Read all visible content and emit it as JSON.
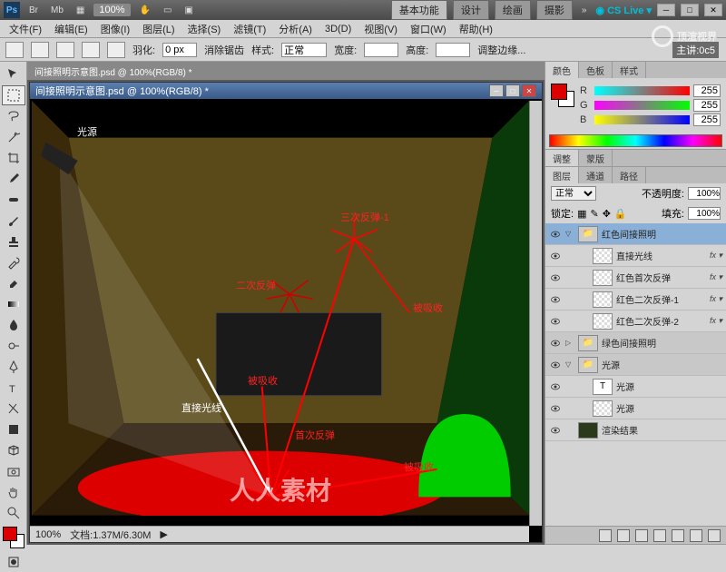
{
  "titlebar": {
    "ps": "Ps",
    "zoom": "100%",
    "workspaces": [
      "基本功能",
      "设计",
      "绘画",
      "摄影"
    ],
    "cslive": "CS Live",
    "lesson": "主讲:0c5"
  },
  "menu": [
    "文件(F)",
    "编辑(E)",
    "图像(I)",
    "图层(L)",
    "选择(S)",
    "滤镜(T)",
    "分析(A)",
    "3D(D)",
    "视图(V)",
    "窗口(W)",
    "帮助(H)"
  ],
  "optbar": {
    "feather_label": "羽化:",
    "feather_value": "0 px",
    "antialias": "消除锯齿",
    "style_label": "样式:",
    "style_value": "正常",
    "width_label": "宽度:",
    "height_label": "高度:",
    "refine": "调整边缘..."
  },
  "doc": {
    "tab": "间接照明示意图.psd @ 100%(RGB/8) *",
    "zoom": "100%",
    "fileinfo": "文档:1.37M/6.30M"
  },
  "annotations": {
    "light": "光源",
    "direct": "直接光线",
    "first_bounce": "首次反弹",
    "second_bounce": "二次反弹",
    "third_bounce": "三次反弹-1",
    "absorbed1": "被吸收",
    "absorbed2": "被吸收",
    "absorbed3": "被吸收"
  },
  "color_panel": {
    "tabs": [
      "颜色",
      "色板",
      "样式"
    ],
    "r": "R",
    "g": "G",
    "b": "B",
    "rv": "255",
    "gv": "255",
    "bv": "255"
  },
  "adjust_panel": {
    "tabs": [
      "调整",
      "蒙版"
    ]
  },
  "layers_panel": {
    "tabs": [
      "图层",
      "通道",
      "路径"
    ],
    "blend": "正常",
    "opacity_label": "不透明度:",
    "opacity": "100%",
    "lock_label": "锁定:",
    "fill_label": "填充:",
    "fill": "100%",
    "fx": "fx",
    "items": [
      {
        "type": "group",
        "name": "红色间接照明",
        "open": true
      },
      {
        "type": "layer",
        "name": "直接光线",
        "indent": 1,
        "fx": true
      },
      {
        "type": "layer",
        "name": "红色首次反弹",
        "indent": 1,
        "fx": true
      },
      {
        "type": "layer",
        "name": "红色二次反弹-1",
        "indent": 1,
        "fx": true
      },
      {
        "type": "layer",
        "name": "红色二次反弹-2",
        "indent": 1,
        "fx": true
      },
      {
        "type": "group",
        "name": "绿色间接照明",
        "open": false
      },
      {
        "type": "group",
        "name": "光源",
        "open": true
      },
      {
        "type": "text",
        "name": "光源",
        "indent": 1
      },
      {
        "type": "layer",
        "name": "光源",
        "indent": 1
      },
      {
        "type": "render",
        "name": "渲染结果"
      }
    ]
  },
  "watermarks": {
    "top": "顶渲视界",
    "bottom": "人人素材"
  }
}
